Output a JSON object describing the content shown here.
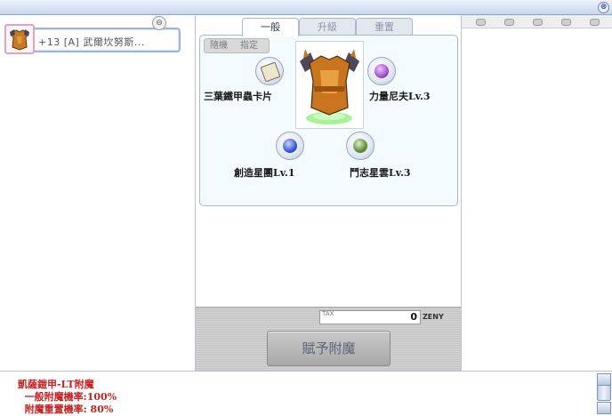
{
  "window": {
    "close_glyph": "⊗"
  },
  "left": {
    "item_name": "+13 [A] 武爾坎努斯...",
    "remove_glyph": "⊖"
  },
  "tabs": [
    {
      "label": "一般",
      "active": true
    },
    {
      "label": "升級",
      "active": false
    },
    {
      "label": "重置",
      "active": false
    }
  ],
  "mode": {
    "random": "隨機",
    "specific": "指定"
  },
  "slots": [
    {
      "label": "三葉鐵甲蟲卡片",
      "icon": "card-icon",
      "color": "#ece6cf"
    },
    {
      "label": "力量尼夫Lv.3",
      "icon": "purple-gem-icon",
      "color": "#a052c8"
    },
    {
      "label": "創造星團Lv.1",
      "icon": "blue-orb-icon",
      "color": "#3a56d9"
    },
    {
      "label": "鬥志星雲Lv.3",
      "icon": "green-orb-icon",
      "color": "#5f8f3a"
    }
  ],
  "tax": {
    "label": "TAX",
    "value": "0",
    "currency": "ZENY"
  },
  "enchant_button": "賦予附魔",
  "info": {
    "title": "凱薩鎧甲-LT附魔",
    "line1": "  一般附魔機率:100%",
    "line2": "  附魔重置機率: 80%"
  }
}
